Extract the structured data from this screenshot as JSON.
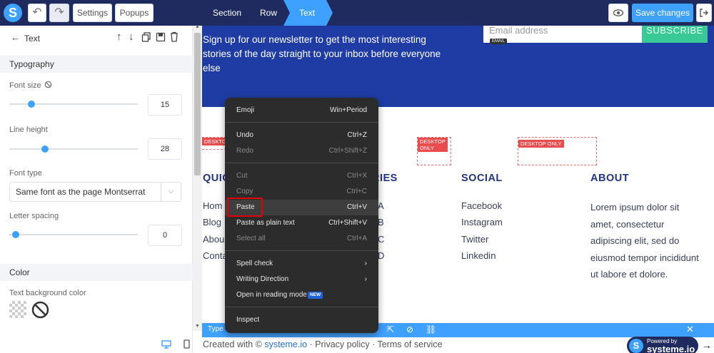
{
  "toolbar": {
    "settings_label": "Settings",
    "popups_label": "Popups",
    "nav_section": "Section",
    "nav_row": "Row",
    "nav_text": "Text",
    "save_label": "Save changes",
    "accent_color": "#3ea0ff",
    "bar_color": "#1f2b5e"
  },
  "sidebar": {
    "title": "Text",
    "typography_section": "Typography",
    "font_size_label": "Font size",
    "font_size_value": "15",
    "font_size_level": 0.12,
    "line_height_label": "Line height",
    "line_height_value": "28",
    "line_height_level": 0.23,
    "font_type_label": "Font type",
    "font_type_value": "Same font as the page Montserrat",
    "letter_spacing_label": "Letter spacing",
    "letter_spacing_value": "0",
    "letter_spacing_level": 0.0,
    "color_section": "Color",
    "text_bg_label": "Text background color"
  },
  "canvas": {
    "newsletter_text": "Sign up for our newsletter to get the most interesting stories of the day straight to your inbox before everyone else",
    "email_placeholder": "Email address",
    "subscribe_label": "SUBSCRIBE",
    "email_badge": "EMAIL",
    "desktop_only": "DESKTOP ONLY",
    "desktop_only_partial": "DESKTO",
    "col_quick": "QUIC",
    "col_categories": "RIES",
    "col_social": "SOCIAL",
    "col_about": "ABOUT",
    "quick_items": [
      "Hom",
      "Blog",
      "Abou",
      "Conta"
    ],
    "category_items": [
      "A",
      "B",
      "C",
      "D"
    ],
    "social_items": [
      "Facebook",
      "Instagram",
      "Twitter",
      "Linkedin"
    ],
    "about_text": "Lorem ipsum dolor sit amet, consectetur adipiscing elit, sed do eiusmod tempor incididunt ut labore et dolore.",
    "bottom_type": "Type of title",
    "footer_prefix": "Created with © ",
    "footer_link": "systeme.io",
    "footer_rest": " · Privacy policy · Terms of service",
    "powered_top": "Powered by",
    "powered_brand": "systeme.io"
  },
  "context_menu": {
    "emoji": "Emoji",
    "emoji_sc": "Win+Period",
    "undo": "Undo",
    "undo_sc": "Ctrl+Z",
    "redo": "Redo",
    "redo_sc": "Ctrl+Shift+Z",
    "cut": "Cut",
    "cut_sc": "Ctrl+X",
    "copy": "Copy",
    "copy_sc": "Ctrl+C",
    "paste": "Paste",
    "paste_sc": "Ctrl+V",
    "paste_plain": "Paste as plain text",
    "paste_plain_sc": "Ctrl+Shift+V",
    "select_all": "Select all",
    "select_all_sc": "Ctrl+A",
    "spell_check": "Spell check",
    "writing_direction": "Writing Direction",
    "reading_mode": "Open in reading mode",
    "new_badge": "NEW",
    "inspect": "Inspect"
  }
}
